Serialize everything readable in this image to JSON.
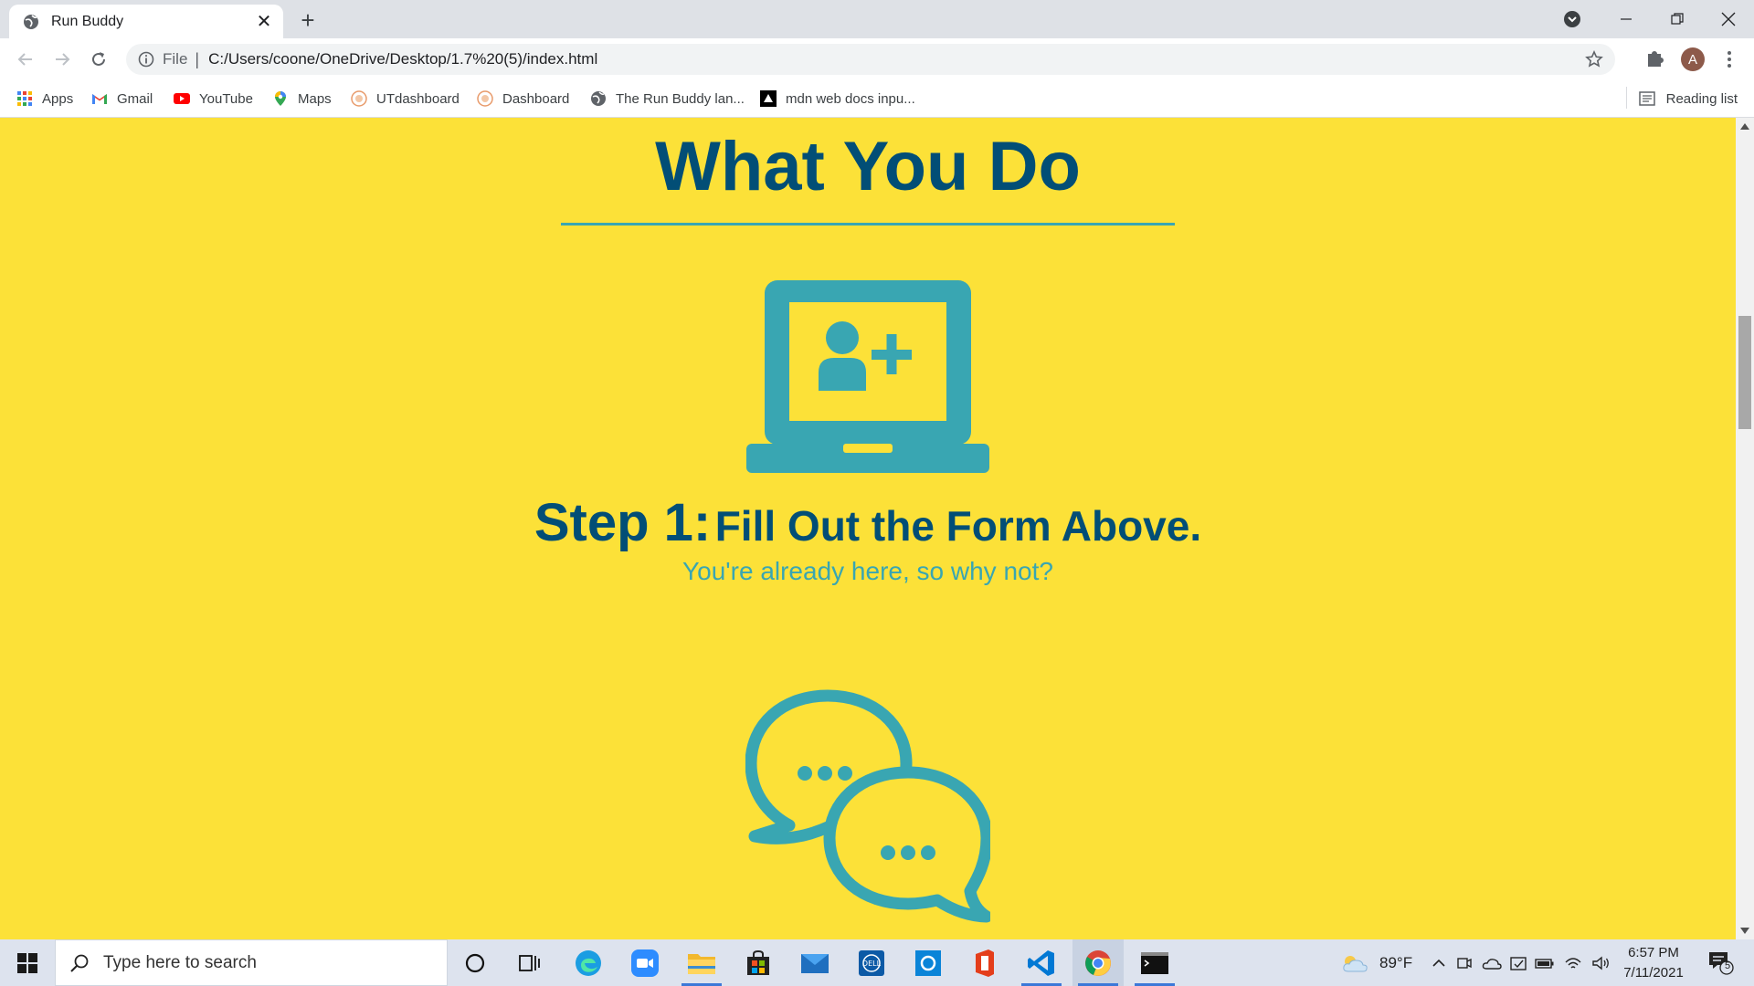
{
  "tab": {
    "title": "Run Buddy"
  },
  "address": {
    "scheme": "File",
    "url": "C:/Users/coone/OneDrive/Desktop/1.7%20(5)/index.html"
  },
  "profile": {
    "initial": "A"
  },
  "bookmarks": [
    {
      "label": "Apps",
      "icon": "apps-grid-icon"
    },
    {
      "label": "Gmail",
      "icon": "gmail-icon"
    },
    {
      "label": "YouTube",
      "icon": "youtube-icon"
    },
    {
      "label": "Maps",
      "icon": "maps-icon"
    },
    {
      "label": "UTdashboard",
      "icon": "utdashboard-icon"
    },
    {
      "label": "Dashboard",
      "icon": "dashboard-icon"
    },
    {
      "label": "The Run Buddy lan...",
      "icon": "globe-icon"
    },
    {
      "label": "mdn web docs inpu...",
      "icon": "mdn-icon"
    }
  ],
  "reading_list": "Reading list",
  "page": {
    "heading": "What You Do",
    "step1": {
      "label": "Step 1:",
      "title": "Fill Out the Form Above.",
      "subtitle": "You're already here, so why not?"
    },
    "colors": {
      "background": "#fce138",
      "primary": "#024e76",
      "accent": "#39a6b2"
    }
  },
  "taskbar": {
    "search_placeholder": "Type here to search",
    "weather": "89°F",
    "time": "6:57 PM",
    "date": "7/11/2021",
    "notifications": "5"
  }
}
